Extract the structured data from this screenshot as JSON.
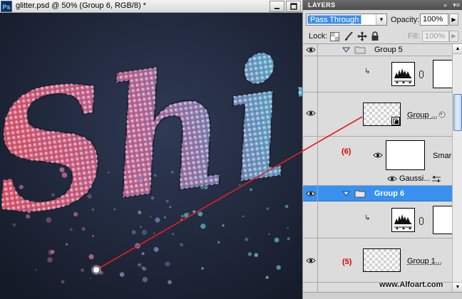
{
  "document": {
    "app_badge": "Ps",
    "title": "glitter.psd @ 50% (Group 6, RGB/8) *",
    "canvas_text": "Shin",
    "colors": {
      "canvas_bg": "#222a3d",
      "glitter_red": "#c8455e",
      "glitter_purple": "#8c64a8",
      "glitter_cyan": "#3fb6c9"
    }
  },
  "panel": {
    "tab_label": "LAYERS",
    "blend_mode": "Pass Through",
    "opacity_label": "Opacity:",
    "opacity_value": "100%",
    "lock_label": "Lock:",
    "fill_label": "Fill:",
    "fill_value": "100%"
  },
  "layers": {
    "group5_name": "Group 5",
    "group_name": "Group ...",
    "smart_name": "Smar",
    "filter_name": "Gaussi...",
    "group6_name": "Group 6",
    "group1_name": "Group 1..."
  },
  "annotations": {
    "label_6": "(6)",
    "label_5": "(5)",
    "arrow_color": "#e41e1e",
    "selection_color": "#3891f1"
  },
  "watermark": "www.Alfoart.com"
}
